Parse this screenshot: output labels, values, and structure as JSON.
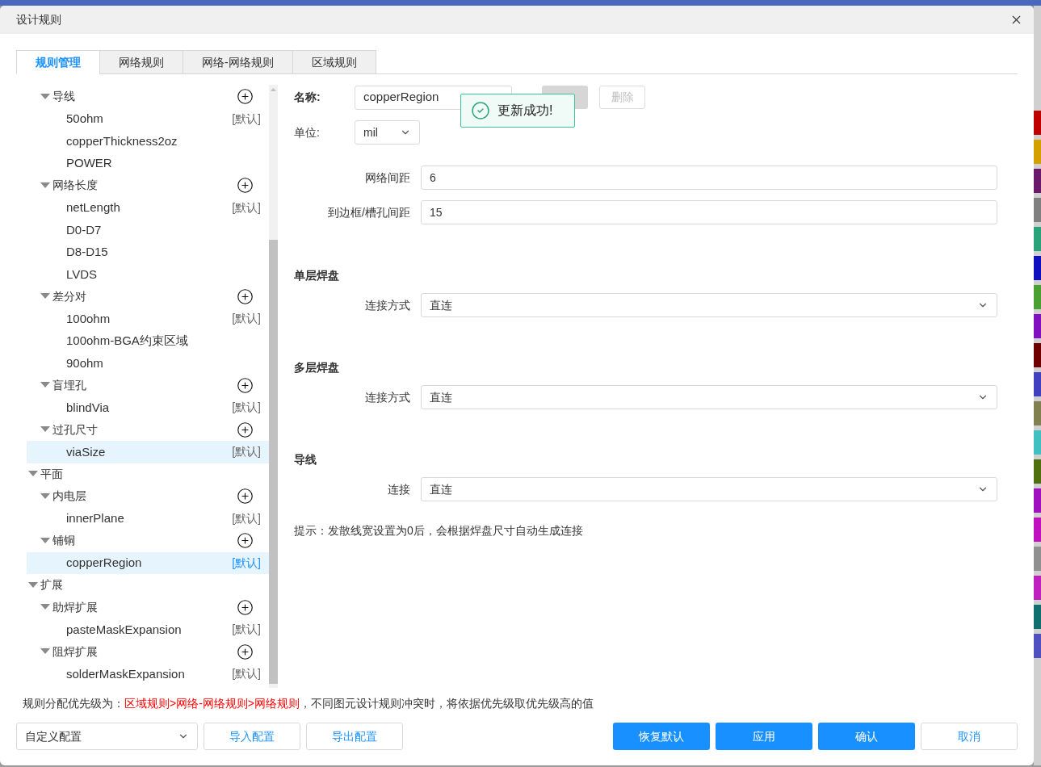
{
  "window": {
    "title": "设计规则"
  },
  "tabs": [
    {
      "label": "规则管理",
      "selected": true
    },
    {
      "label": "网络规则",
      "selected": false
    },
    {
      "label": "网络-网络规则",
      "selected": false
    },
    {
      "label": "区域规则",
      "selected": false
    }
  ],
  "tree": [
    {
      "kind": "rule_set",
      "label": "导线",
      "expanded": true,
      "children": [
        {
          "kind": "rule",
          "label": "50ohm",
          "tag": "[默认]",
          "selected": false,
          "highlighted": false
        },
        {
          "kind": "rule",
          "label": "copperThickness2oz",
          "selected": false,
          "highlighted": false
        },
        {
          "kind": "rule",
          "label": "POWER",
          "selected": false,
          "highlighted": false
        }
      ]
    },
    {
      "kind": "rule_set",
      "label": "网络长度",
      "expanded": true,
      "children": [
        {
          "kind": "rule",
          "label": "netLength",
          "tag": "[默认]",
          "selected": false,
          "highlighted": false
        },
        {
          "kind": "rule",
          "label": "D0-D7",
          "selected": false,
          "highlighted": false
        },
        {
          "kind": "rule",
          "label": "D8-D15",
          "selected": false,
          "highlighted": false
        },
        {
          "kind": "rule",
          "label": "LVDS",
          "selected": false,
          "highlighted": false
        }
      ]
    },
    {
      "kind": "rule_set",
      "label": "差分对",
      "expanded": true,
      "children": [
        {
          "kind": "rule",
          "label": "100ohm",
          "tag": "[默认]",
          "selected": false,
          "highlighted": false
        },
        {
          "kind": "rule",
          "label": "100ohm-BGA约束区域",
          "selected": false,
          "highlighted": false
        },
        {
          "kind": "rule",
          "label": "90ohm",
          "selected": false,
          "highlighted": false
        }
      ]
    },
    {
      "kind": "rule_set",
      "label": "盲埋孔",
      "expanded": true,
      "children": [
        {
          "kind": "rule",
          "label": "blindVia",
          "tag": "[默认]",
          "selected": false,
          "highlighted": false
        }
      ]
    },
    {
      "kind": "rule_set",
      "label": "过孔尺寸",
      "expanded": true,
      "children": [
        {
          "kind": "rule",
          "label": "viaSize",
          "tag": "[默认]",
          "selected": false,
          "highlighted": true
        }
      ]
    },
    {
      "kind": "group",
      "label": "平面",
      "expanded": true,
      "children": [
        {
          "kind": "rule_set",
          "label": "内电层",
          "expanded": true,
          "children": [
            {
              "kind": "rule",
              "label": "innerPlane",
              "tag": "[默认]",
              "selected": false,
              "highlighted": false
            }
          ]
        },
        {
          "kind": "rule_set",
          "label": "铺铜",
          "expanded": true,
          "children": [
            {
              "kind": "rule",
              "label": "copperRegion",
              "tag": "[默认]",
              "selected": true
            }
          ]
        }
      ]
    },
    {
      "kind": "group",
      "label": "扩展",
      "expanded": true,
      "children": [
        {
          "kind": "rule_set",
          "label": "助焊扩展",
          "expanded": true,
          "children": [
            {
              "kind": "rule",
              "label": "pasteMaskExpansion",
              "tag": "[默认]",
              "selected": false,
              "highlighted": false
            }
          ]
        },
        {
          "kind": "rule_set",
          "label": "阻焊扩展",
          "expanded": true,
          "children": [
            {
              "kind": "rule",
              "label": "solderMaskExpansion",
              "tag": "[默认]",
              "selected": false,
              "highlighted": false
            }
          ]
        }
      ]
    }
  ],
  "name": {
    "label": "名称:",
    "value": "copperRegion"
  },
  "unit": {
    "label": "单位:",
    "value": "mil"
  },
  "delete_button": {
    "label": "删除",
    "disabled": true
  },
  "toast": {
    "message": "更新成功!"
  },
  "spacing_fields": [
    {
      "label": "网络间距",
      "value": "6"
    },
    {
      "label": "到边框/槽孔间距",
      "value": "15"
    }
  ],
  "sections": [
    {
      "title": "单层焊盘",
      "label": "连接方式",
      "value": "直连"
    },
    {
      "title": "多层焊盘",
      "label": "连接方式",
      "value": "直连"
    },
    {
      "title": "导线",
      "label": "连接",
      "value": "直连"
    }
  ],
  "hint": "提示：发散线宽设置为0后，会根据焊盘尺寸自动生成连接",
  "priority_note": {
    "prefix": "规则分配优先级为：",
    "highlight": "区域规则>网络-网络规则>网络规则",
    "suffix": "，不同图元设计规则冲突时，将依据优先级取优先级高的值"
  },
  "config_select": {
    "value": "自定义配置"
  },
  "left_buttons": [
    "导入配置",
    "导出配置"
  ],
  "right_buttons": [
    {
      "label": "恢复默认",
      "kind": "primary"
    },
    {
      "label": "应用",
      "kind": "primary"
    },
    {
      "label": "确认",
      "kind": "primary"
    },
    {
      "label": "取消",
      "kind": "secondary"
    }
  ],
  "background_swatches": [
    {
      "color": "#c00000"
    },
    {
      "color": "#d4a000"
    },
    {
      "color": "#6b1a6b"
    },
    {
      "color": "#808080"
    },
    {
      "color": "#2aa37a"
    },
    {
      "color": "#1010c0"
    },
    {
      "color": "#4aa030"
    },
    {
      "color": "#8010c0"
    },
    {
      "color": "#700000"
    },
    {
      "color": "#4040c0"
    },
    {
      "color": "#808050"
    },
    {
      "color": "#40c0c0"
    },
    {
      "color": "#507010"
    },
    {
      "color": "#a010c0"
    },
    {
      "color": "#c010c0"
    },
    {
      "color": "#909090"
    },
    {
      "color": "#c020c0"
    },
    {
      "color": "#107070"
    },
    {
      "color": "#5050c0"
    }
  ]
}
